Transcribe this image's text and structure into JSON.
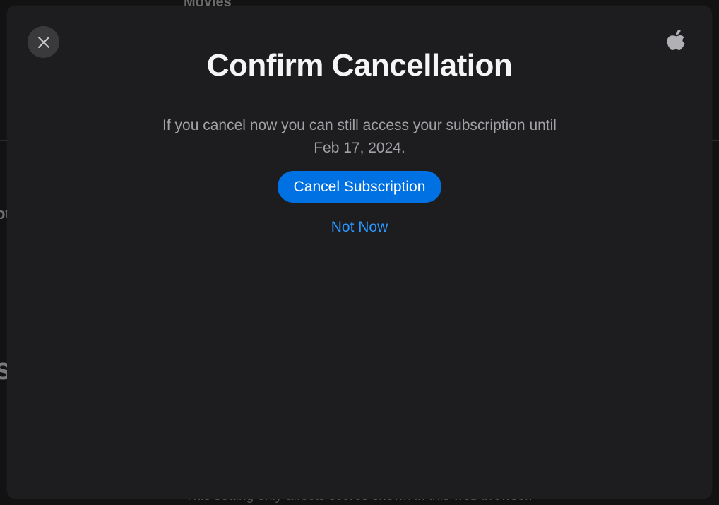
{
  "background": {
    "section_title": "Movies",
    "left_fragment_1": "ot",
    "left_fragment_2": "s",
    "footer_note": "This setting only affects scores shown in this web browser."
  },
  "modal": {
    "title": "Confirm Cancellation",
    "message": "If you cancel now you can still access your subscription until Feb 17, 2024.",
    "primary_button_label": "Cancel Subscription",
    "secondary_link_label": "Not Now",
    "close_icon": "close-icon",
    "brand_icon": "apple-logo-icon"
  },
  "colors": {
    "modal_bg": "#1d1d1f",
    "accent": "#0071e3",
    "link": "#2997ff",
    "title_text": "#f5f5f7",
    "body_text": "#a1a1a6"
  }
}
